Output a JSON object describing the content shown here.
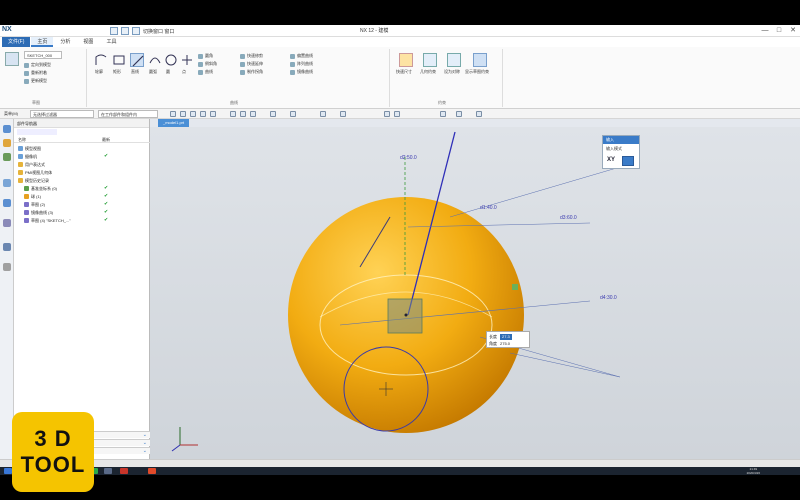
{
  "app": {
    "logo": "NX",
    "window_title": "NX 12 - 建模",
    "quick_access_text": "切换窗口  窗口"
  },
  "window_controls": [
    "—",
    "□",
    "✕"
  ],
  "tabs": [
    {
      "label": "文件(F)",
      "file": true
    },
    {
      "label": "主页",
      "active": true
    },
    {
      "label": "分析"
    },
    {
      "label": "视图"
    },
    {
      "label": "工具"
    }
  ],
  "ribbon": {
    "sketch_name": "SKETCH_000",
    "small_items_left": [
      "定向到模型",
      "重新附着",
      "更新模型"
    ],
    "btn_labels": [
      "轮廓",
      "矩形",
      "直线",
      "圆弧",
      "圆",
      "点"
    ],
    "small_items_mid1": [
      "圆角",
      "倒斜角",
      "曲线"
    ],
    "small_items_mid2": [
      "快速修剪",
      "快速延伸",
      "制作拐角"
    ],
    "small_items_mid3": [
      "偏置曲线",
      "阵列曲线",
      "镜像曲线"
    ],
    "constraint_labels": [
      "快速尺寸",
      "几何约束",
      "设为对称",
      "显示草图约束"
    ],
    "group_names": [
      "草图",
      "曲线",
      "约束"
    ]
  },
  "selection_bar": {
    "filter_label": "菜单(M)",
    "type_filter": "无选择过滤器",
    "scope": "在工作部件和组件内"
  },
  "navigator": {
    "title": "部件导航器",
    "col_name": "名称",
    "col_update": "最新",
    "tree": [
      {
        "label": "模型视图",
        "indent": 2,
        "color": "#6aa0d8"
      },
      {
        "label": "摄像机",
        "indent": 2,
        "color": "#6aa0d8",
        "check": true
      },
      {
        "label": "用户表达式",
        "indent": 2,
        "color": "#e6b33a"
      },
      {
        "label": "PMI视图几何体",
        "indent": 2,
        "color": "#e6b33a"
      },
      {
        "label": "模型历史记录",
        "indent": 2,
        "color": "#e6b33a"
      },
      {
        "label": "基准坐标系 (0)",
        "indent": 8,
        "color": "#5a9e4a",
        "check": true
      },
      {
        "label": "球 (1)",
        "indent": 8,
        "color": "#e6a020",
        "check": true
      },
      {
        "label": "草图 (2)",
        "indent": 8,
        "color": "#7b6fc8",
        "check": true
      },
      {
        "label": "镜像曲线 (3)",
        "indent": 8,
        "color": "#7b6fc8",
        "check": true
      },
      {
        "label": "草图 (4) \"SKETCH_...\"",
        "indent": 8,
        "color": "#7b6fc8",
        "check": true
      }
    ]
  },
  "graphics_tab": "_model1.prt",
  "dimensions": [
    {
      "text": "d2:50.0"
    },
    {
      "text": "d1:40.0"
    },
    {
      "text": "d3:60.0"
    },
    {
      "text": "d4:30.0"
    }
  ],
  "picker": {
    "title": "输入",
    "label": "输入模式",
    "xy": "XY"
  },
  "tooltip": {
    "len_label": "长度",
    "len_value": "27.3",
    "angle_label": "角度",
    "angle_value": "275.0"
  },
  "taskbar": {
    "time": "21:49",
    "date": "2020/4/26"
  },
  "brand": {
    "line1": "3 D",
    "line2": "TOOL",
    "color": "#f5c400"
  }
}
